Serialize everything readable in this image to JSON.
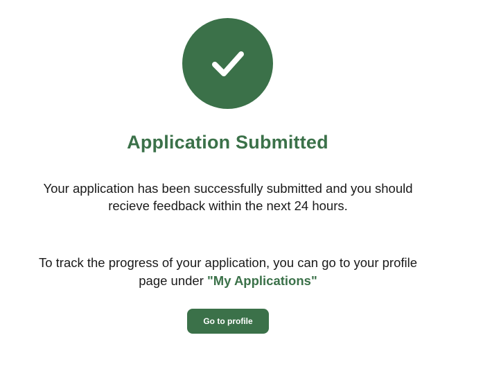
{
  "confirmation": {
    "icon": "checkmark-icon",
    "title": "Application Submitted",
    "message": "Your application has been successfully submitted and you should recieve feedback within the next 24 hours.",
    "track_prefix": "To track the progress of your application, you can go to your profile page under ",
    "track_link": "\"My Applications\"",
    "button_label": "Go to profile"
  },
  "colors": {
    "accent": "#3b7149",
    "text": "#1a1a1a",
    "background": "#ffffff"
  }
}
